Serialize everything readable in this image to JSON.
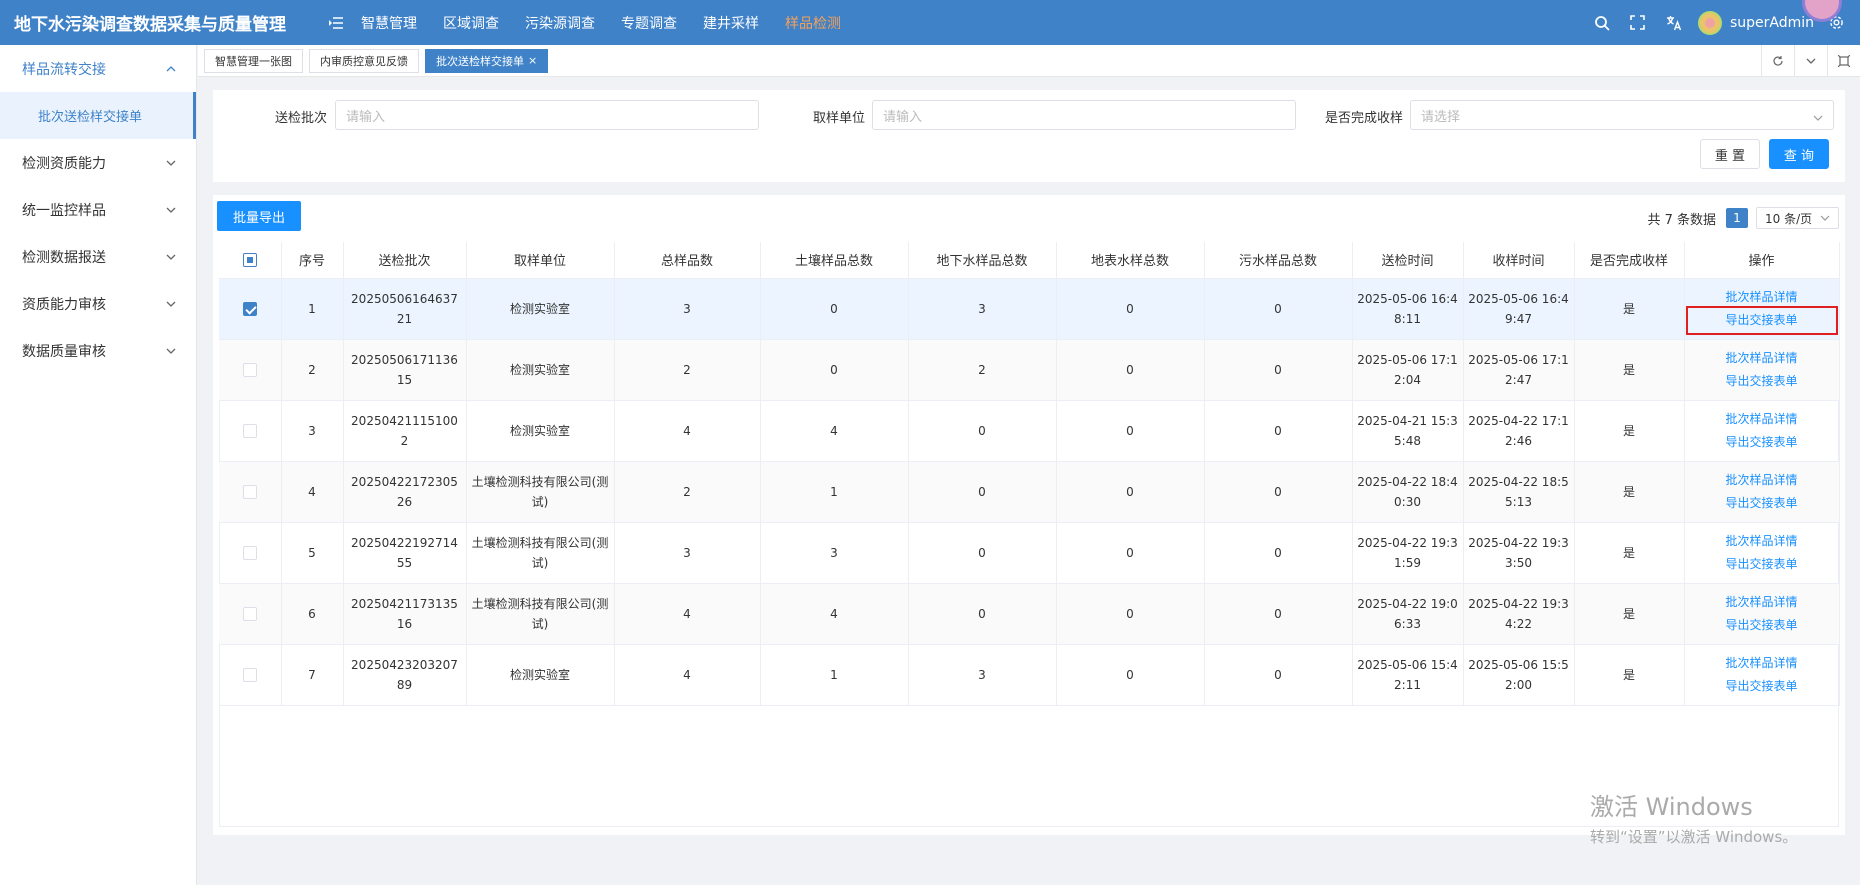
{
  "app": {
    "title": "地下水污染调查数据采集与质量管理"
  },
  "topnav": [
    {
      "label": "智慧管理",
      "active": false
    },
    {
      "label": "区域调查",
      "active": false
    },
    {
      "label": "污染源调查",
      "active": false
    },
    {
      "label": "专题调查",
      "active": false
    },
    {
      "label": "建井采样",
      "active": false
    },
    {
      "label": "样品检测",
      "active": true
    }
  ],
  "user": {
    "name": "superAdmin"
  },
  "sidebar": {
    "groups": [
      {
        "label": "样品流转交接",
        "expanded": true,
        "children": [
          {
            "label": "批次送检样交接单",
            "active": true
          }
        ]
      },
      {
        "label": "检测资质能力",
        "expanded": false
      },
      {
        "label": "统一监控样品",
        "expanded": false
      },
      {
        "label": "检测数据报送",
        "expanded": false
      },
      {
        "label": "资质能力审核",
        "expanded": false
      },
      {
        "label": "数据质量审核",
        "expanded": false
      }
    ]
  },
  "tabs": [
    {
      "label": "智慧管理一张图",
      "active": false
    },
    {
      "label": "内审质控意见反馈",
      "active": false
    },
    {
      "label": "批次送检样交接单",
      "active": true,
      "close": "×"
    }
  ],
  "search": {
    "batch_label": "送检批次",
    "batch_placeholder": "请输入",
    "unit_label": "取样单位",
    "unit_placeholder": "请输入",
    "done_label": "是否完成收样",
    "done_placeholder": "请选择",
    "reset_label": "重 置",
    "query_label": "查 询"
  },
  "toolbar": {
    "export_label": "批量导出"
  },
  "pager": {
    "total": "共 7 条数据",
    "page": "1",
    "size": "10 条/页"
  },
  "table": {
    "headers": [
      "序号",
      "送检批次",
      "取样单位",
      "总样品数",
      "土壤样品总数",
      "地下水样品总数",
      "地表水样总数",
      "污水样品总数",
      "送检时间",
      "收样时间",
      "是否完成收样",
      "操作"
    ],
    "op_detail": "批次样品详情",
    "op_export": "导出交接表单",
    "rows": [
      {
        "no": "1",
        "batch": "2025050616463721",
        "unit": "检测实验室",
        "total": "3",
        "soil": "0",
        "ground": "3",
        "surface": "0",
        "sewage": "0",
        "send": "2025-05-06 16:48:11",
        "recv": "2025-05-06 16:49:47",
        "done": "是",
        "checked": true
      },
      {
        "no": "2",
        "batch": "2025050617113615",
        "unit": "检测实验室",
        "total": "2",
        "soil": "0",
        "ground": "2",
        "surface": "0",
        "sewage": "0",
        "send": "2025-05-06 17:12:04",
        "recv": "2025-05-06 17:12:47",
        "done": "是",
        "checked": false
      },
      {
        "no": "3",
        "batch": "202504211151002",
        "unit": "检测实验室",
        "total": "4",
        "soil": "4",
        "ground": "0",
        "surface": "0",
        "sewage": "0",
        "send": "2025-04-21 15:35:48",
        "recv": "2025-04-22 17:12:46",
        "done": "是",
        "checked": false
      },
      {
        "no": "4",
        "batch": "2025042217230526",
        "unit": "土壤检测科技有限公司(测试)",
        "total": "2",
        "soil": "1",
        "ground": "0",
        "surface": "0",
        "sewage": "0",
        "send": "2025-04-22 18:40:30",
        "recv": "2025-04-22 18:55:13",
        "done": "是",
        "checked": false
      },
      {
        "no": "5",
        "batch": "2025042219271455",
        "unit": "土壤检测科技有限公司(测试)",
        "total": "3",
        "soil": "3",
        "ground": "0",
        "surface": "0",
        "sewage": "0",
        "send": "2025-04-22 19:31:59",
        "recv": "2025-04-22 19:33:50",
        "done": "是",
        "checked": false
      },
      {
        "no": "6",
        "batch": "2025042117313516",
        "unit": "土壤检测科技有限公司(测试)",
        "total": "4",
        "soil": "4",
        "ground": "0",
        "surface": "0",
        "sewage": "0",
        "send": "2025-04-22 19:06:33",
        "recv": "2025-04-22 19:34:22",
        "done": "是",
        "checked": false
      },
      {
        "no": "7",
        "batch": "2025042320320789",
        "unit": "检测实验室",
        "total": "4",
        "soil": "1",
        "ground": "3",
        "surface": "0",
        "sewage": "0",
        "send": "2025-05-06 15:42:11",
        "recv": "2025-05-06 15:52:00",
        "done": "是",
        "checked": false
      }
    ]
  },
  "watermark": {
    "line1": "激活 Windows",
    "line2": "转到“设置”以激活 Windows。"
  },
  "colors": {
    "primary": "#3f82c8",
    "button": "#1890ff",
    "active_nav": "#f5a05a",
    "highlight": "#e02020"
  }
}
